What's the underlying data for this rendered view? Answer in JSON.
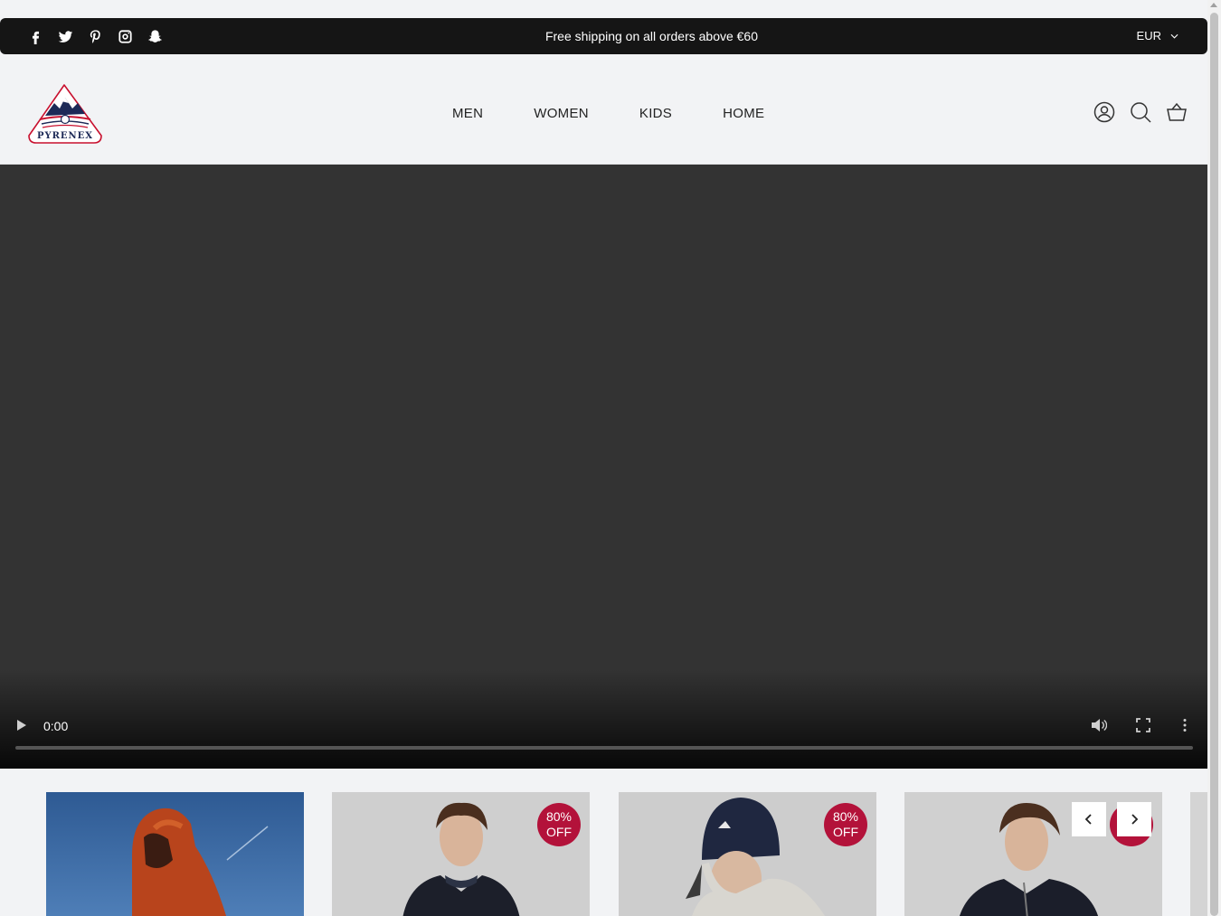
{
  "announcement": {
    "text": "Free shipping on all orders above €60",
    "currency": "EUR",
    "socials": [
      "facebook-icon",
      "twitter-icon",
      "pinterest-icon",
      "instagram-icon",
      "snapchat-icon"
    ]
  },
  "header": {
    "logo_text": "PYRENEX",
    "nav": [
      "MEN",
      "WOMEN",
      "KIDS",
      "HOME"
    ],
    "icons": [
      "account-icon",
      "search-icon",
      "cart-icon"
    ]
  },
  "video": {
    "time": "0:00",
    "progress": 0
  },
  "carousel": {
    "badges": [
      "80%\nOFF",
      "80%\nOFF"
    ],
    "badge_line1": "80%",
    "badge_line2": "OFF"
  },
  "colors": {
    "announce_bg": "#151515",
    "page_bg": "#f2f3f5",
    "video_bg": "#333333",
    "badge": "#b3123a",
    "logo_red": "#c8102e",
    "logo_navy": "#1d2a57"
  }
}
